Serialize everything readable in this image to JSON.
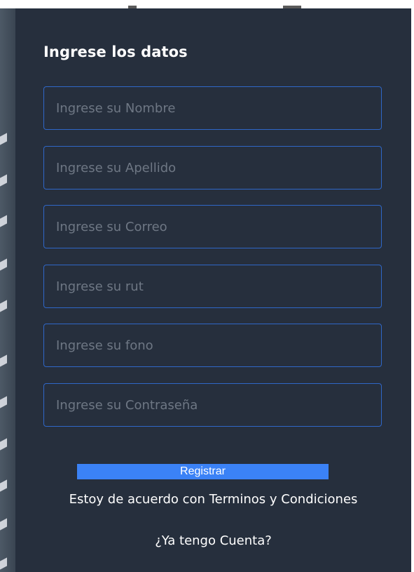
{
  "form": {
    "title": "Ingrese los datos",
    "fields": [
      {
        "name": "nombre",
        "placeholder": "Ingrese su Nombre",
        "value": ""
      },
      {
        "name": "apellido",
        "placeholder": "Ingrese su Apellido",
        "value": ""
      },
      {
        "name": "correo",
        "placeholder": "Ingrese su Correo",
        "value": ""
      },
      {
        "name": "rut",
        "placeholder": "Ingrese su rut",
        "value": ""
      },
      {
        "name": "fono",
        "placeholder": "Ingrese su fono",
        "value": ""
      },
      {
        "name": "contrasena",
        "placeholder": "Ingrese su Contraseña",
        "value": ""
      }
    ],
    "submit_label": "Registrar",
    "terms_text": "Estoy de acuerdo con Terminos y Condiciones",
    "login_link": "¿Ya tengo Cuenta?"
  },
  "colors": {
    "card_background": "#262f3d",
    "field_border": "#2f67c8",
    "button_background": "#3b82f6",
    "text": "#ffffff",
    "placeholder": "#6e7784"
  }
}
